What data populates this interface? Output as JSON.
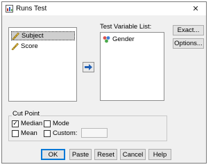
{
  "window": {
    "title": "Runs Test"
  },
  "icons": {
    "app": "runs-test-icon",
    "close": "close-icon",
    "scale_variable": "ruler-icon",
    "nominal_variable": "nominal-variable-icon",
    "move_arrow": "arrow-right-icon"
  },
  "source_variables": [
    {
      "label": "Subject",
      "selected": true
    },
    {
      "label": "Score",
      "selected": false
    }
  ],
  "test_variable_list": {
    "label": "Test Variable List:",
    "items": [
      {
        "label": "Gender"
      }
    ]
  },
  "side_buttons": {
    "exact": "Exact...",
    "options": "Options..."
  },
  "cut_point": {
    "label": "Cut Point",
    "median": {
      "label": "Median",
      "checked": true
    },
    "mode": {
      "label": "Mode",
      "checked": false
    },
    "mean": {
      "label": "Mean",
      "checked": false
    },
    "custom": {
      "label": "Custom:",
      "checked": false,
      "value": ""
    }
  },
  "buttons": {
    "ok": "OK",
    "paste": "Paste",
    "reset": "Reset",
    "cancel": "Cancel",
    "help": "Help"
  },
  "colors": {
    "default_button_border": "#0078d7",
    "selected_item": "#cfcfcf",
    "dialog_bg": "#f0f0f0"
  }
}
